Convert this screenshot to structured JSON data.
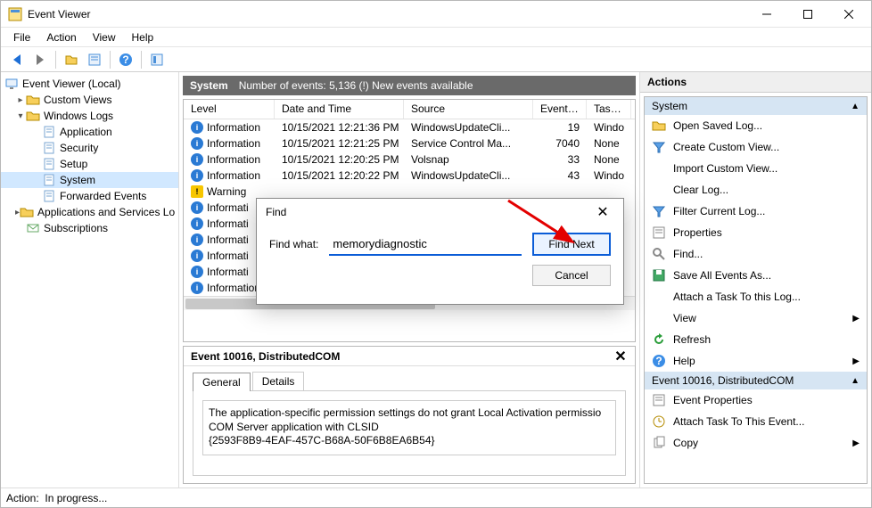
{
  "window": {
    "title": "Event Viewer"
  },
  "menubar": [
    "File",
    "Action",
    "View",
    "Help"
  ],
  "tree": {
    "root": "Event Viewer (Local)",
    "items": [
      {
        "label": "Custom Views",
        "icon": "folder",
        "indent": 1,
        "twist": "closed"
      },
      {
        "label": "Windows Logs",
        "icon": "folder",
        "indent": 1,
        "twist": "open"
      },
      {
        "label": "Application",
        "icon": "log",
        "indent": 2,
        "twist": ""
      },
      {
        "label": "Security",
        "icon": "log",
        "indent": 2,
        "twist": ""
      },
      {
        "label": "Setup",
        "icon": "log",
        "indent": 2,
        "twist": ""
      },
      {
        "label": "System",
        "icon": "log",
        "indent": 2,
        "twist": "",
        "selected": true
      },
      {
        "label": "Forwarded Events",
        "icon": "log",
        "indent": 2,
        "twist": ""
      },
      {
        "label": "Applications and Services Lo",
        "icon": "folder",
        "indent": 1,
        "twist": "closed"
      },
      {
        "label": "Subscriptions",
        "icon": "subs",
        "indent": 1,
        "twist": ""
      }
    ]
  },
  "center": {
    "title": "System",
    "subtitle": "Number of events: 5,136 (!) New events available",
    "columns": [
      "Level",
      "Date and Time",
      "Source",
      "Event ID",
      "Task Ca"
    ],
    "rows": [
      {
        "level": "Information",
        "lvl": "info",
        "date": "10/15/2021 12:21:36 PM",
        "source": "WindowsUpdateCli...",
        "id": "19",
        "task": "Windo"
      },
      {
        "level": "Information",
        "lvl": "info",
        "date": "10/15/2021 12:21:25 PM",
        "source": "Service Control Ma...",
        "id": "7040",
        "task": "None"
      },
      {
        "level": "Information",
        "lvl": "info",
        "date": "10/15/2021 12:20:25 PM",
        "source": "Volsnap",
        "id": "33",
        "task": "None"
      },
      {
        "level": "Information",
        "lvl": "info",
        "date": "10/15/2021 12:20:22 PM",
        "source": "WindowsUpdateCli...",
        "id": "43",
        "task": "Windo"
      },
      {
        "level": "Warning",
        "lvl": "warn",
        "date": "",
        "source": "",
        "id": "",
        "task": ""
      },
      {
        "level": "Informati",
        "lvl": "info",
        "date": "",
        "source": "",
        "id": "",
        "task": ""
      },
      {
        "level": "Informati",
        "lvl": "info",
        "date": "",
        "source": "",
        "id": "",
        "task": ""
      },
      {
        "level": "Informati",
        "lvl": "info",
        "date": "",
        "source": "",
        "id": "",
        "task": ""
      },
      {
        "level": "Informati",
        "lvl": "info",
        "date": "",
        "source": "",
        "id": "",
        "task": ""
      },
      {
        "level": "Informati",
        "lvl": "info",
        "date": "",
        "source": "",
        "id": "",
        "task": ""
      },
      {
        "level": "Information",
        "lvl": "info",
        "date": "",
        "source": "",
        "id": "",
        "task": ""
      }
    ],
    "details": {
      "title": "Event 10016, DistributedCOM",
      "tabs": [
        "General",
        "Details"
      ],
      "text_lines": [
        "The application-specific permission settings do not grant Local Activation permissio",
        "COM Server application with CLSID",
        "{2593F8B9-4EAF-457C-B68A-50F6B8EA6B54}"
      ]
    }
  },
  "actions": {
    "header": "Actions",
    "groups": [
      {
        "title": "System",
        "items": [
          {
            "icon": "open",
            "label": "Open Saved Log..."
          },
          {
            "icon": "filter-new",
            "label": "Create Custom View..."
          },
          {
            "icon": "",
            "label": "Import Custom View..."
          },
          {
            "icon": "",
            "label": "Clear Log..."
          },
          {
            "icon": "filter",
            "label": "Filter Current Log..."
          },
          {
            "icon": "props",
            "label": "Properties"
          },
          {
            "icon": "find",
            "label": "Find..."
          },
          {
            "icon": "save",
            "label": "Save All Events As..."
          },
          {
            "icon": "",
            "label": "Attach a Task To this Log..."
          },
          {
            "icon": "",
            "label": "View",
            "submenu": true
          },
          {
            "icon": "refresh",
            "label": "Refresh"
          },
          {
            "icon": "help",
            "label": "Help",
            "submenu": true
          }
        ]
      },
      {
        "title": "Event 10016, DistributedCOM",
        "items": [
          {
            "icon": "props",
            "label": "Event Properties"
          },
          {
            "icon": "task",
            "label": "Attach Task To This Event..."
          },
          {
            "icon": "copy",
            "label": "Copy",
            "submenu": true
          }
        ]
      }
    ]
  },
  "find": {
    "title": "Find",
    "label": "Find what:",
    "value": "memorydiagnostic",
    "next": "Find Next",
    "cancel": "Cancel"
  },
  "status": {
    "label": "Action:",
    "value": "In progress..."
  }
}
